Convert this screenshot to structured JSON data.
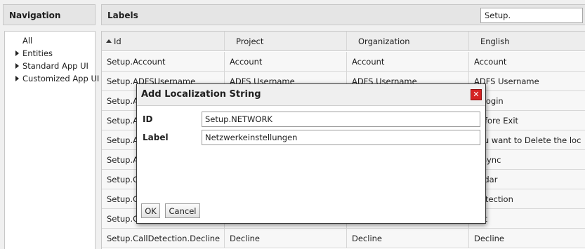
{
  "navigation": {
    "title": "Navigation",
    "items": [
      {
        "label": "All",
        "expandable": false
      },
      {
        "label": "Entities",
        "expandable": true
      },
      {
        "label": "Standard App UI",
        "expandable": true
      },
      {
        "label": "Customized App UI",
        "expandable": true
      }
    ]
  },
  "labels": {
    "title": "Labels",
    "search_value": "Setup.",
    "columns": [
      "Id",
      "Project",
      "Organization",
      "English"
    ],
    "sorted_column": "Id",
    "sort_icon": "sort-ascending-icon",
    "rows": [
      [
        "Setup.Account",
        "Account",
        "Account",
        "Account"
      ],
      [
        "Setup.ADFSUsername",
        "ADFS Username",
        "ADFS Username",
        "ADFS Username"
      ],
      [
        "Setup.A",
        "",
        "",
        "o Login"
      ],
      [
        "Setup.A",
        "",
        "",
        "Before Exit"
      ],
      [
        "Setup.A",
        "",
        "",
        "you want to Delete the loc"
      ],
      [
        "Setup.A",
        "",
        "",
        "o Sync"
      ],
      [
        "Setup.C",
        "",
        "",
        "endar"
      ],
      [
        "Setup.C",
        "",
        "",
        "Detection"
      ],
      [
        "Setup.C",
        "",
        "",
        "ept"
      ],
      [
        "Setup.CallDetection.Decline",
        "Decline",
        "Decline",
        "Decline"
      ]
    ]
  },
  "dialog": {
    "title": "Add Localization String",
    "close_icon": "close-icon",
    "close_color": "#d42323",
    "id_label": "ID",
    "id_value": "Setup.NETWORK",
    "label_label": "Label",
    "label_value": "Netzwerkeinstellungen",
    "ok_label": "OK",
    "cancel_label": "Cancel"
  }
}
